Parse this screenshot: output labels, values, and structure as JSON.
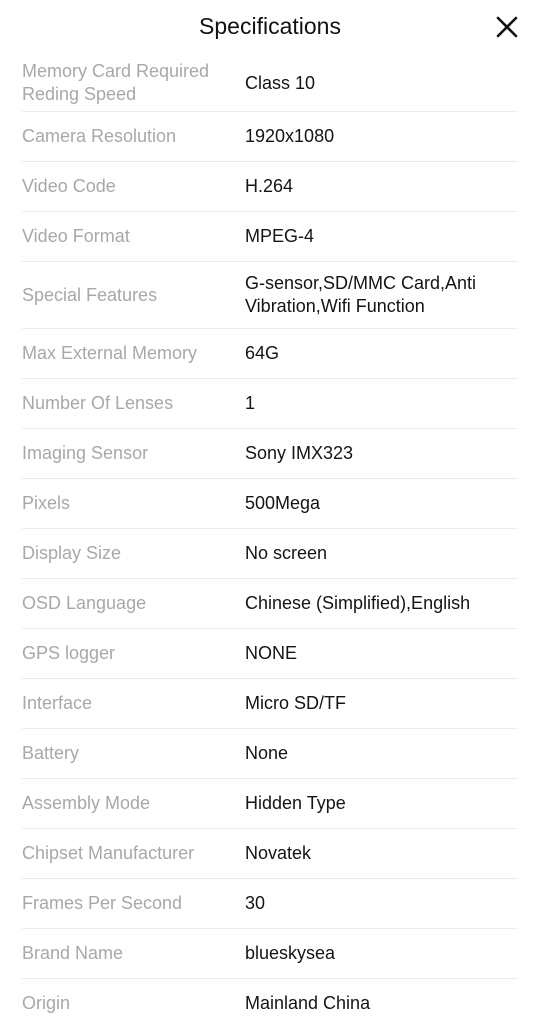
{
  "header": {
    "title": "Specifications",
    "close_icon": "close-icon"
  },
  "specs": [
    {
      "label": "Memory Card Required Reding Speed",
      "value": "Class 10"
    },
    {
      "label": "Camera Resolution",
      "value": "1920x1080"
    },
    {
      "label": "Video Code",
      "value": "H.264"
    },
    {
      "label": "Video Format",
      "value": "MPEG-4"
    },
    {
      "label": "Special Features",
      "value": "G-sensor,SD/MMC Card,Anti Vibration,Wifi Function"
    },
    {
      "label": "Max External Memory",
      "value": "64G"
    },
    {
      "label": "Number Of Lenses",
      "value": "1"
    },
    {
      "label": "Imaging Sensor",
      "value": "Sony IMX323"
    },
    {
      "label": "Pixels",
      "value": "500Mega"
    },
    {
      "label": "Display Size",
      "value": "No screen"
    },
    {
      "label": "OSD Language",
      "value": "Chinese (Simplified),English"
    },
    {
      "label": "GPS logger",
      "value": "NONE"
    },
    {
      "label": "Interface",
      "value": "Micro SD/TF"
    },
    {
      "label": "Battery",
      "value": "None"
    },
    {
      "label": "Assembly Mode",
      "value": "Hidden Type"
    },
    {
      "label": "Chipset Manufacturer",
      "value": "Novatek"
    },
    {
      "label": "Frames Per Second",
      "value": "30"
    },
    {
      "label": "Brand Name",
      "value": "blueskysea"
    },
    {
      "label": "Origin",
      "value": "Mainland China"
    }
  ]
}
